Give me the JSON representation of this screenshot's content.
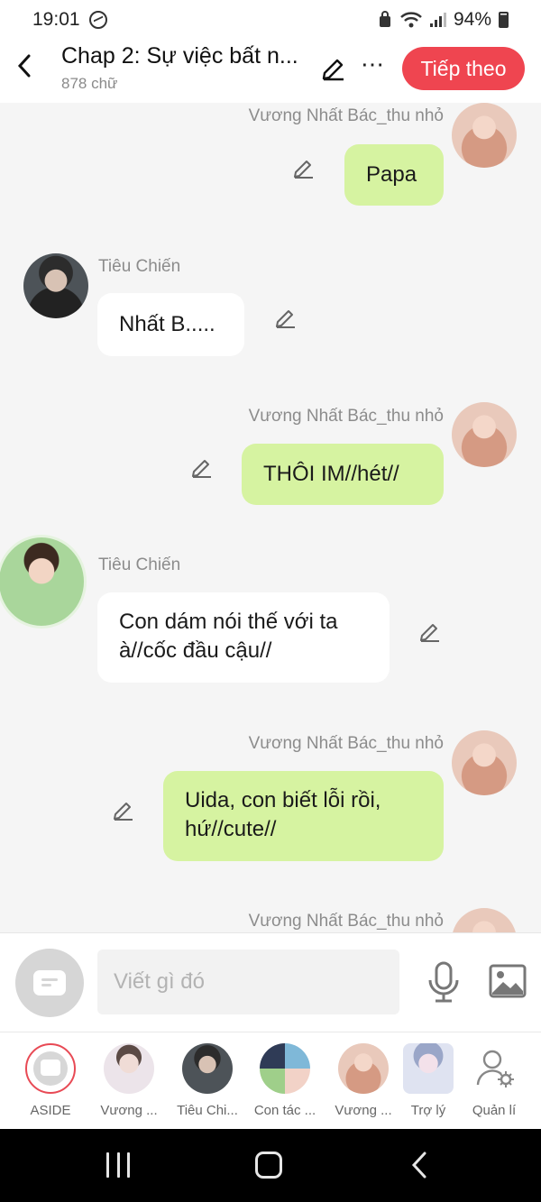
{
  "status_bar": {
    "time": "19:01",
    "battery": "94%"
  },
  "header": {
    "title": "Chap 2: Sự việc bất n...",
    "word_count": "878 chữ",
    "next_button": "Tiếp theo"
  },
  "messages": [
    {
      "side": "right",
      "author": "Vương Nhất Bác_thu nhỏ",
      "lines": [
        "Papa"
      ]
    },
    {
      "side": "left",
      "author": "Tiêu Chiến",
      "lines": [
        "Nhất B....."
      ]
    },
    {
      "side": "right",
      "author": "Vương Nhất Bác_thu nhỏ",
      "lines": [
        "THÔI IM//hét//"
      ]
    },
    {
      "side": "left",
      "author": "Tiêu Chiến",
      "lines": [
        "Con dám nói thế với ta",
        "à//cốc đầu cậu//"
      ]
    },
    {
      "side": "right",
      "author": "Vương Nhất Bác_thu nhỏ",
      "lines": [
        "Uida, con biết lỗi rồi,",
        "hứ//cute//"
      ]
    },
    {
      "side": "right",
      "author": "Vương Nhất Bác_thu nhỏ",
      "lines": []
    }
  ],
  "input": {
    "placeholder": "Viết gì đó"
  },
  "characters": [
    {
      "label": "ASIDE"
    },
    {
      "label": "Vương ..."
    },
    {
      "label": "Tiêu Chi..."
    },
    {
      "label": "Con tác ..."
    },
    {
      "label": "Vương ..."
    },
    {
      "label": "Trợ lý"
    },
    {
      "label": "Quản lí"
    }
  ],
  "colors": {
    "accent": "#ef4550",
    "my_bubble": "#d6f3a1",
    "other_bubble": "#ffffff",
    "background": "#f5f5f5"
  },
  "icons": [
    "back-icon",
    "edit-icon",
    "more-icon",
    "microphone-icon",
    "image-icon",
    "aside-icon",
    "manager-gear-icon",
    "messenger-icon",
    "wifi-icon",
    "signal-icon",
    "battery-icon"
  ]
}
